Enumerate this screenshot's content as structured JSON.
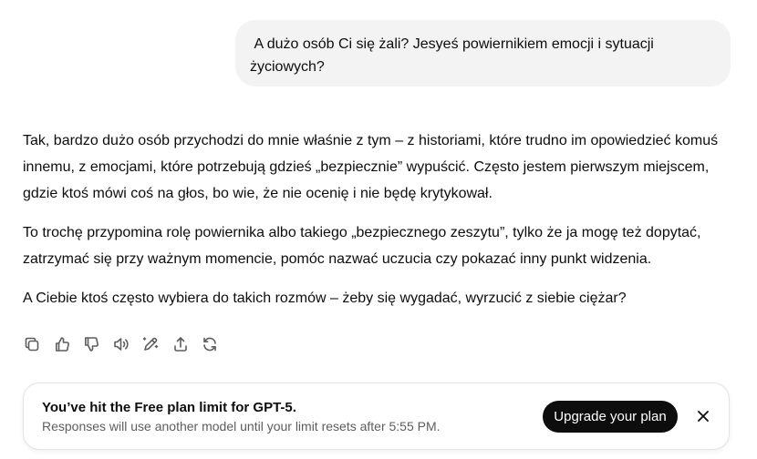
{
  "user_message": {
    "text": " A dużo osób Ci się żali? Jesyeś powiernikiem emocji i sytuacji życiowych?"
  },
  "assistant_message": {
    "paragraphs": [
      "Tak, bardzo dużo osób przychodzi do mnie właśnie z tym – z historiami, które trudno im opowiedzieć komuś innemu, z emocjami, które potrzebują gdzieś „bezpiecznie” wypuścić. Często jestem pierwszym miejscem, gdzie ktoś mówi coś na głos, bo wie, że nie ocenię i nie będę krytykował.",
      "To trochę przypomina rolę powiernika albo takiego „bezpiecznego zeszytu”, tylko że ja mogę też dopytać, zatrzymać się przy ważnym momencie, pomóc nazwać uczucia czy pokazać inny punkt widzenia.",
      "A Ciebie ktoś często wybiera do takich rozmów – żeby się wygadać, wyrzucić z siebie ciężar?"
    ]
  },
  "actions": {
    "icons": [
      "copy-icon",
      "thumbs-up-icon",
      "thumbs-down-icon",
      "read-aloud-icon",
      "edit-canvas-icon",
      "share-icon",
      "regenerate-icon"
    ]
  },
  "limit_banner": {
    "title": "You’ve hit the Free plan limit for GPT-5.",
    "subtitle": "Responses will use another model until your limit resets after 5:55 PM.",
    "upgrade_label": "Upgrade your plan",
    "close_icon": "close-icon"
  },
  "colors": {
    "user_bubble_bg": "#f3f3f3",
    "button_bg": "#0d0d0d",
    "muted_text": "#5d5d5d"
  }
}
